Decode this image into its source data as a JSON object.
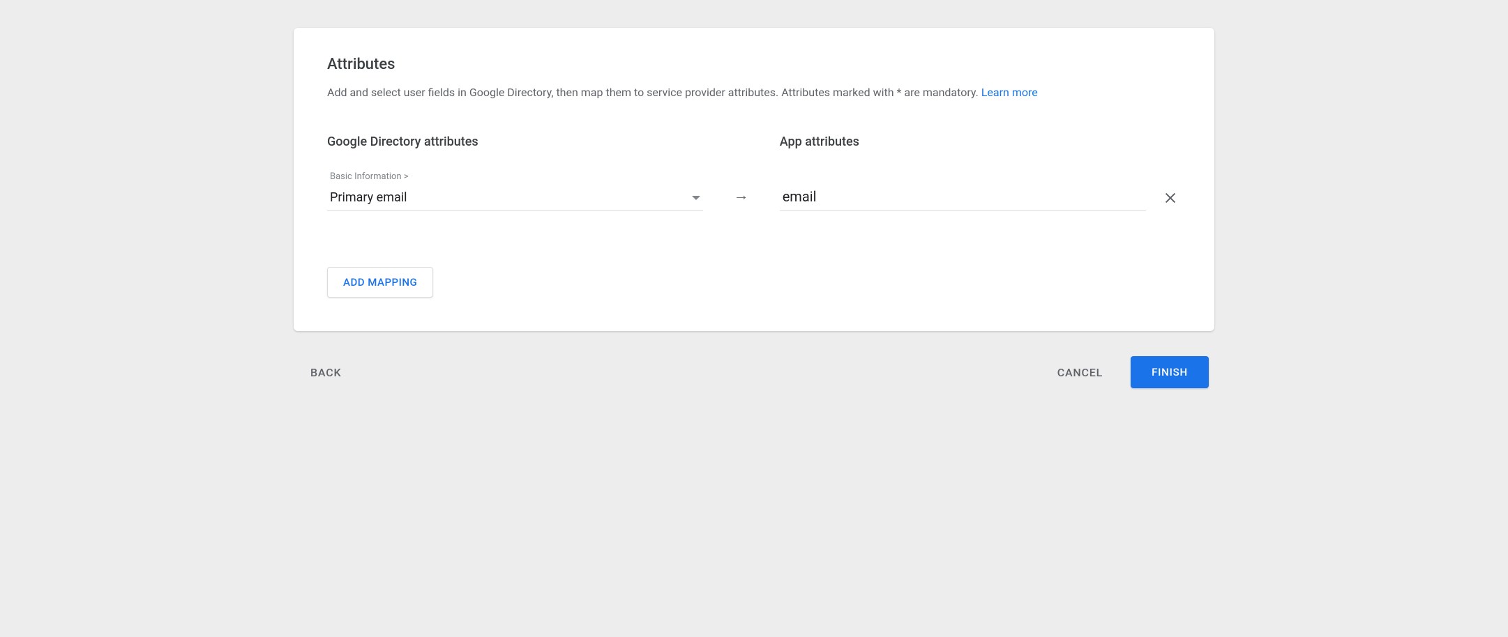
{
  "card": {
    "title": "Attributes",
    "description": "Add and select user fields in Google Directory, then map them to service provider attributes. Attributes marked with * are mandatory. ",
    "learn_more": "Learn more"
  },
  "columns": {
    "source_header": "Google Directory attributes",
    "target_header": "App attributes"
  },
  "mappings": [
    {
      "source_category": "Basic Information >",
      "source_value": "Primary email",
      "target_value": "email"
    }
  ],
  "buttons": {
    "add_mapping": "ADD MAPPING",
    "back": "BACK",
    "cancel": "CANCEL",
    "finish": "FINISH"
  }
}
